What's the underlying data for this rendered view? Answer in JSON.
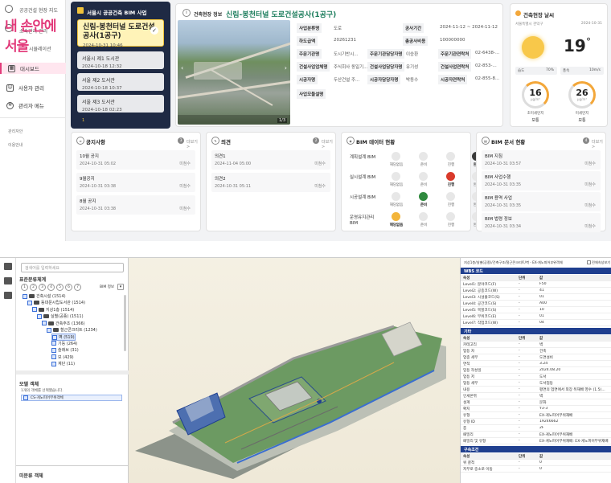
{
  "sidebar": {
    "topline": "공공건설 현장 지도",
    "subline": "소속관리 관리",
    "overlay_title": "내 손안에 서울",
    "sim_label": "시뮬레이션",
    "nav": [
      {
        "label": "대시보드",
        "icon": "dashboard-icon",
        "active": true
      },
      {
        "label": "사용자 관리",
        "icon": "user-icon",
        "active": false
      },
      {
        "label": "관리자 메뉴",
        "icon": "gear-icon",
        "active": false
      }
    ],
    "minor": [
      "관리자안",
      "이용안내"
    ]
  },
  "projects": {
    "header": "서울시 공공건축 BIM 사업",
    "items": [
      {
        "title": "신림-봉천터널 도로건설공사(1공구)",
        "date": "2024-10-31 10:46",
        "selected": true
      },
      {
        "title": "서울시 제1 도시관",
        "date": "2024-10-18 12:32",
        "selected": false
      },
      {
        "title": "서울 제2 도서관",
        "date": "2024-10-18 10:37",
        "selected": false
      },
      {
        "title": "서울 제3 도서관",
        "date": "2024-10-18 02:23",
        "selected": false
      }
    ],
    "page": "1"
  },
  "site_info": {
    "label": "건축현장 정보",
    "title": "신림-봉천터널 도로건설공사(1공구)",
    "photo_counter": "1/3",
    "fields": {
      "biz_type": {
        "k": "사업분류명",
        "v": "도로"
      },
      "period": {
        "k": "공사기간",
        "v": "2024-11-12 ~ 2024-11-12"
      },
      "ha": {
        "k": "하도급액",
        "v": "20261231"
      },
      "total_amt": {
        "k": "총공사비용",
        "v": "100000000"
      },
      "client": {
        "k": "주문기관명",
        "v": "도시기반시..."
      },
      "client_mgr": {
        "k": "주문기관담당자명",
        "v": "이승환"
      },
      "client_tel": {
        "k": "주문기관연락처",
        "v": "02-6438-..."
      },
      "builder": {
        "k": "건설사업업체명",
        "v": "주식회사 동일기..."
      },
      "builder_mgr": {
        "k": "건설사업담당자명",
        "v": "유기성"
      },
      "builder_tel": {
        "k": "건설사업연락처",
        "v": "02-853-..."
      },
      "contractor": {
        "k": "시공자명",
        "v": "두산건설 주..."
      },
      "contractor_mgr": {
        "k": "시공자담당자명",
        "v": "박동수"
      },
      "contractor_tel": {
        "k": "시공자연락처",
        "v": "02-855-8..."
      },
      "desc": {
        "k": "사업모듈설명",
        "v": ""
      }
    }
  },
  "weather": {
    "label": "건축현장 날씨",
    "location": "서울특별시 관악구",
    "date": "2024-10-31",
    "temp": "19",
    "unit": "°",
    "humidity_label": "습도",
    "humidity": "70%",
    "wind_label": "풍속",
    "wind": "10m/s",
    "pm10": {
      "value": "16",
      "unit": "μg/m³",
      "label": "초미세먼지",
      "status": "보통"
    },
    "pm25": {
      "value": "26",
      "unit": "μg/m³",
      "label": "미세먼지",
      "status": "보통"
    }
  },
  "notices": {
    "title": "공지사항",
    "count": "3",
    "more": "더보기 >",
    "items": [
      {
        "title": "10월 공지",
        "date": "2024-10-31 05:02",
        "status": "미첨수"
      },
      {
        "title": "9월공지",
        "date": "2024-10-31 03:38",
        "status": "미첨수"
      },
      {
        "title": "8월 공지",
        "date": "2024-10-31 03:38",
        "status": "미첨수"
      }
    ]
  },
  "opinions": {
    "title": "의견",
    "count": "2",
    "more": "더보기 >",
    "items": [
      {
        "title": "의견1",
        "date": "2024-11-04 05:00",
        "status": "미첨수"
      },
      {
        "title": "의견2",
        "date": "2024-10-31 05:11",
        "status": "미첨수"
      }
    ]
  },
  "bim_status": {
    "title": "BIM 데이터 현황",
    "steps": [
      "해당없음",
      "준비",
      "진행",
      "완료"
    ],
    "rows": [
      {
        "label": "계획설계 BIM",
        "active": 3,
        "color": "#3a3a3a"
      },
      {
        "label": "실시설계 BIM",
        "active": 2,
        "color": "#d93a2b"
      },
      {
        "label": "시공설계 BIM",
        "active": 1,
        "color": "#2f8a3e"
      },
      {
        "label": "운영유지관리 BIM",
        "active": 0,
        "color": "#f3b53a"
      }
    ]
  },
  "bim_docs": {
    "title": "BIM 문서 현황",
    "count": "4",
    "more": "더보기 >",
    "items": [
      {
        "title": "BIM 지침",
        "date": "2024-10-31 03:57",
        "status": "미첨수"
      },
      {
        "title": "BIM 사업수행",
        "date": "2024-10-31 03:35",
        "status": "미첨수"
      },
      {
        "title": "BIM 용역 사업",
        "date": "2024-10-31 03:35",
        "status": "미첨수"
      },
      {
        "title": "BIM 법령 정보",
        "date": "2024-10-31 03:34",
        "status": "미첨수"
      }
    ]
  },
  "viewer": {
    "search_placeholder": "검색어를 입력하세요",
    "tree_title": "표준분류체계",
    "levels": [
      "1",
      "2",
      "3",
      "4",
      "5",
      "6",
      "7"
    ],
    "bim_label": "BIM 정보",
    "tree": [
      {
        "label": "건축시설 (1514)",
        "depth": 0
      },
      {
        "label": "동대문시립도서관 (1514)",
        "depth": 1
      },
      {
        "label": "지상1층 (1514)",
        "depth": 2
      },
      {
        "label": "실별(공종) (1511)",
        "depth": 3
      },
      {
        "label": "건축주조 (1366)",
        "depth": 4
      },
      {
        "label": "철근콘크리트 (1234)",
        "depth": 5
      },
      {
        "label": "벽 (519)",
        "depth": 6,
        "highlight": true
      },
      {
        "label": "기둥 (264)",
        "depth": 6
      },
      {
        "label": "슬래브 (31)",
        "depth": 6
      },
      {
        "label": "보 (429)",
        "depth": 6
      },
      {
        "label": "계단 (11)",
        "depth": 6
      }
    ],
    "model_title": "모델 객체",
    "model_note": "1개의 객체를 선택했습니다.",
    "model_item": "CS-게노피어부위객체",
    "bottom_title": "미분류 객체",
    "props_path": "지상1층/실별(공종)/건축구조/철근콘크리트/벽 - EX-게노피어부위객체",
    "props_check": "전체속성보기",
    "wbs_header": "WBS 코드",
    "col_attr": "속성",
    "col_unit": "단위",
    "col_value": "값",
    "wbs_rows": [
      [
        "Level1: 분야코드(F)",
        "-",
        "F50"
      ],
      [
        "Level2: 공종코드(W)",
        "-",
        "41"
      ],
      [
        "Level3: 시설물코드(S)",
        "-",
        "01"
      ],
      [
        "Level4: 공간코드(S)",
        "-",
        "A00"
      ],
      [
        "Level5: 목할코드(S)",
        "-",
        "10"
      ],
      [
        "Level6: 부위코드(E)",
        "-",
        "01"
      ],
      [
        "Level7: 작업코드(W)",
        "-",
        "04"
      ]
    ],
    "etc_header": "기타",
    "etc_rows": [
      [
        "카테고리",
        "-",
        "벽"
      ],
      [
        "업등 자",
        "-",
        "건축"
      ],
      [
        "업종 세부",
        "-",
        "도면설비"
      ],
      [
        "면적",
        "-",
        "3.24"
      ],
      [
        "입등 작성일",
        "-",
        "2024.08.20"
      ],
      [
        "업등 저",
        "-",
        "도서"
      ],
      [
        "업등 세부",
        "-",
        "도서업등"
      ],
      [
        "내용",
        "-",
        "평면의 업면에서 외장 뒤재배 영수 (1.5)..."
      ],
      [
        "인셰온뮈",
        "-",
        "벽"
      ],
      [
        "설계",
        "-",
        "문화"
      ],
      [
        "확지",
        "-",
        "Y3-3"
      ],
      [
        "유형",
        "-",
        "EX-게노피어부위재배"
      ],
      [
        "유형 ID",
        "-",
        "19246662"
      ],
      [
        "층",
        "-",
        "2F"
      ],
      [
        "패밀리",
        "-",
        "EX-게노피어부위재배"
      ],
      [
        "패밀리 및 유형",
        "-",
        "EX-게노피어부위재배: EX-게노피어부위재배"
      ]
    ],
    "struct_header": "구속조건",
    "struct_rows": [
      [
        "위 결척",
        "-",
        "0"
      ],
      [
        "저부로 중소로 이동",
        "-",
        "0"
      ]
    ]
  }
}
